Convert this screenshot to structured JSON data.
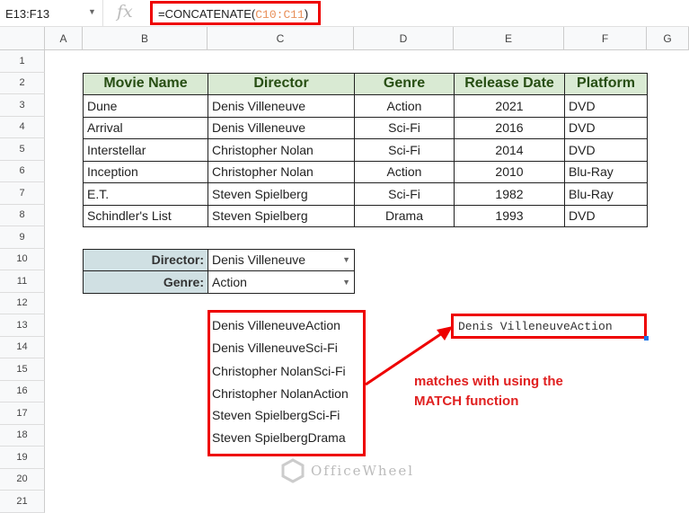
{
  "formula_bar": {
    "name_box": "E13:F13",
    "fx": "fx",
    "formula_prefix": "=CONCATENATE(",
    "formula_ref": "C10:C11",
    "formula_suffix": ")"
  },
  "columns": [
    "A",
    "B",
    "C",
    "D",
    "E",
    "F",
    "G"
  ],
  "rows": [
    "1",
    "2",
    "3",
    "4",
    "5",
    "6",
    "7",
    "8",
    "9",
    "10",
    "11",
    "12",
    "13",
    "14",
    "15",
    "16",
    "17",
    "18",
    "19",
    "20",
    "21"
  ],
  "table": {
    "headers": [
      "Movie Name",
      "Director",
      "Genre",
      "Release Date",
      "Platform"
    ],
    "rows": [
      [
        "Dune",
        "Denis Villeneuve",
        "Action",
        "2021",
        "DVD"
      ],
      [
        "Arrival",
        "Denis Villeneuve",
        "Sci-Fi",
        "2016",
        "DVD"
      ],
      [
        "Interstellar",
        "Christopher Nolan",
        "Sci-Fi",
        "2014",
        "DVD"
      ],
      [
        "Inception",
        "Christopher Nolan",
        "Action",
        "2010",
        "Blu-Ray"
      ],
      [
        "E.T.",
        "Steven Spielberg",
        "Sci-Fi",
        "1982",
        "Blu-Ray"
      ],
      [
        "Schindler's List",
        "Steven Spielberg",
        "Drama",
        "1993",
        "DVD"
      ]
    ]
  },
  "criteria": [
    {
      "label": "Director:",
      "value": "Denis Villeneuve"
    },
    {
      "label": "Genre:",
      "value": "Action"
    }
  ],
  "concat_list": [
    "Denis VilleneuveAction",
    "Denis VilleneuveSci-Fi",
    "Christopher NolanSci-Fi",
    "Christopher NolanAction",
    "Steven SpielbergSci-Fi",
    "Steven SpielbergDrama"
  ],
  "result": "Denis VilleneuveAction",
  "annotation": [
    "matches with using the",
    "MATCH function"
  ],
  "watermark": "OfficeWheel"
}
